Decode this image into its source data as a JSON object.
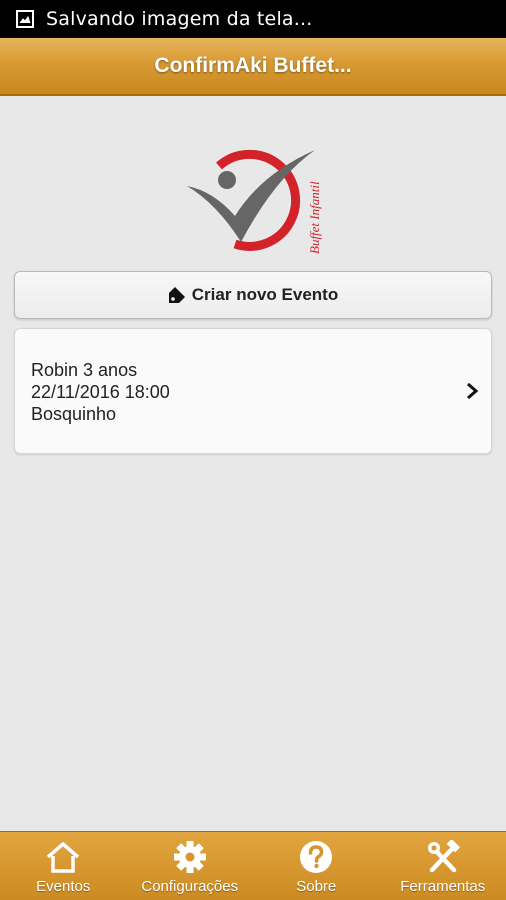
{
  "status_bar": {
    "notification_text": "Salvando imagem da tela..."
  },
  "header": {
    "title": "ConfirmAki Buffet..."
  },
  "logo": {
    "tagline": "Buffet Infantil",
    "accent_color": "#d2232a",
    "check_color": "#666666"
  },
  "create_button": {
    "label": "Criar novo Evento",
    "icon": "tag-icon"
  },
  "events": [
    {
      "name": "Robin 3 anos",
      "datetime": "22/11/2016 18:00",
      "location": "Bosquinho"
    }
  ],
  "tabs": [
    {
      "label": "Eventos",
      "icon": "home-icon"
    },
    {
      "label": "Configurações",
      "icon": "gear-icon"
    },
    {
      "label": "Sobre",
      "icon": "help-icon"
    },
    {
      "label": "Ferramentas",
      "icon": "tools-icon"
    }
  ],
  "theme": {
    "bar_color": "#d7962d",
    "background": "#e8e8e8"
  }
}
